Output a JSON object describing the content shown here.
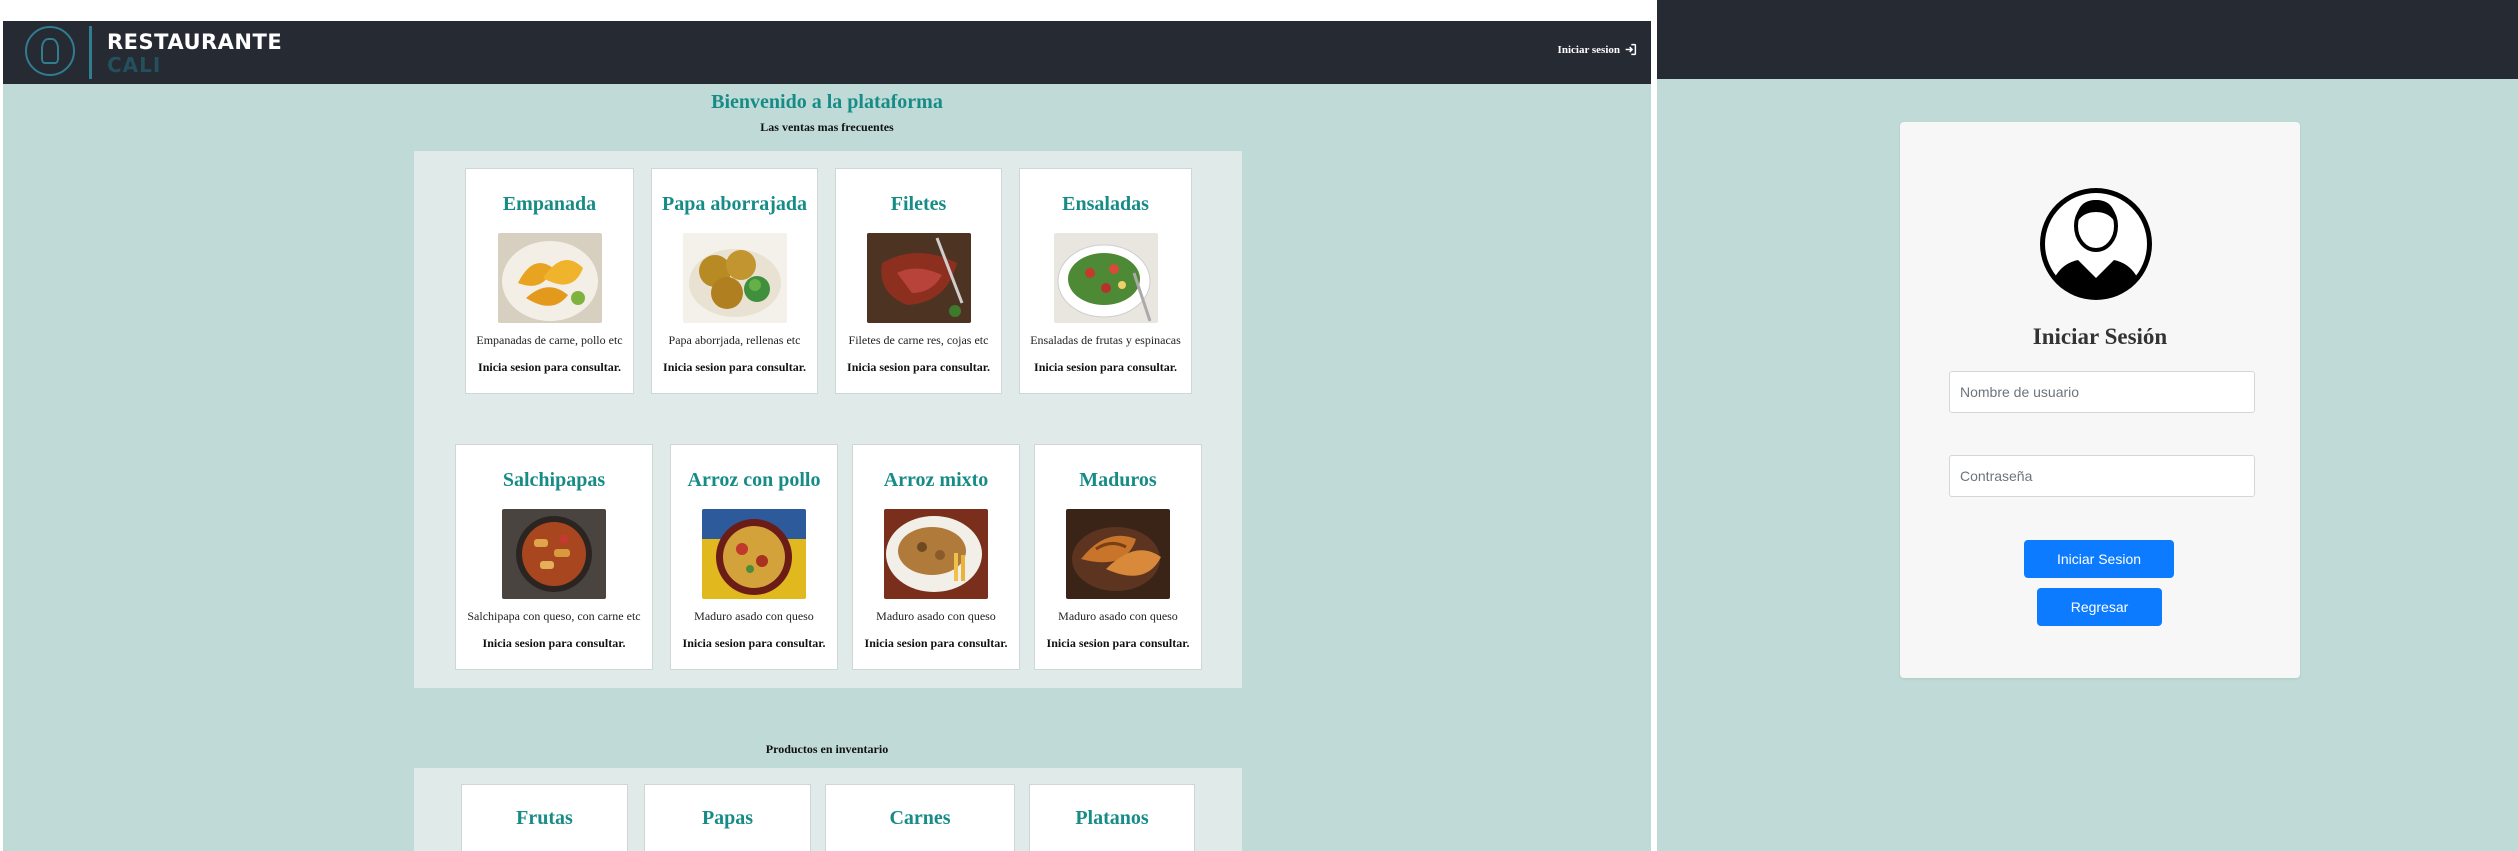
{
  "nav": {
    "brand_title": "RESTAURANTE",
    "brand_sub": "CALI",
    "login_link": "Iniciar sesion"
  },
  "main": {
    "welcome": "Bienvenido a la plataforma",
    "subtitle": "Las ventas mas frecuentes",
    "products": [
      {
        "title": "Empanada",
        "desc": "Empanadas de carne, pollo etc",
        "note": "Inicia sesion para consultar.",
        "image": "empanada-photo"
      },
      {
        "title": "Papa aborrajada",
        "desc": "Papa aborrjada, rellenas etc",
        "note": "Inicia sesion para consultar.",
        "image": "papa-photo"
      },
      {
        "title": "Filetes",
        "desc": "Filetes de carne res, cojas etc",
        "note": "Inicia sesion para consultar.",
        "image": "filete-photo"
      },
      {
        "title": "Ensaladas",
        "desc": "Ensaladas de frutas y espinacas",
        "note": "Inicia sesion para consultar.",
        "image": "ensalada-photo"
      },
      {
        "title": "Salchipapas",
        "desc": "Salchipapa con queso, con carne etc",
        "note": "Inicia sesion para consultar.",
        "image": "salchipapa-photo"
      },
      {
        "title": "Arroz con pollo",
        "desc": "Maduro asado con queso",
        "note": "Inicia sesion para consultar.",
        "image": "arroz-pollo-photo"
      },
      {
        "title": "Arroz mixto",
        "desc": "Maduro asado con queso",
        "note": "Inicia sesion para consultar.",
        "image": "arroz-mixto-photo"
      },
      {
        "title": "Maduros",
        "desc": "Maduro asado con queso",
        "note": "Inicia sesion para consultar.",
        "image": "maduros-photo"
      }
    ],
    "inventory_title": "Productos en inventario",
    "inventory": [
      {
        "title": "Frutas"
      },
      {
        "title": "Papas"
      },
      {
        "title": "Carnes"
      },
      {
        "title": "Platanos"
      }
    ]
  },
  "login": {
    "title": "Iniciar Sesión",
    "username_placeholder": "Nombre de usuario",
    "password_placeholder": "Contraseña",
    "submit_label": "Iniciar Sesion",
    "back_label": "Regresar"
  },
  "colors": {
    "nav_bg": "#262a33",
    "page_bg": "#c0dbd7",
    "accent_teal": "#178c87",
    "primary_button": "#0d7bff"
  }
}
